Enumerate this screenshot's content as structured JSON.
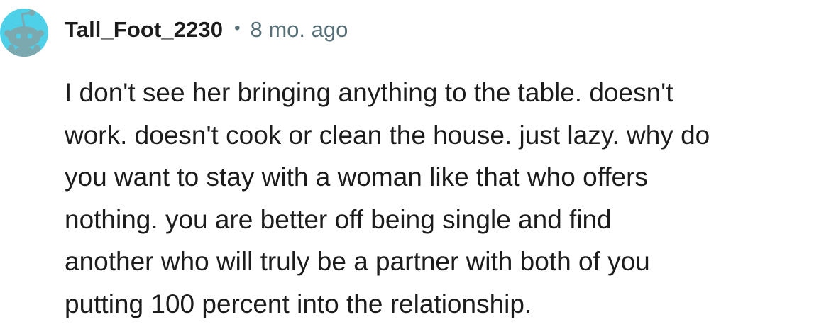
{
  "comment": {
    "username": "Tall_Foot_2230",
    "separator": "•",
    "timestamp": "8 mo. ago",
    "avatar_icon": "reddit-snoo-avatar-icon",
    "lines": [
      "I don't see her bringing anything to the table. doesn't",
      "work. doesn't cook or clean the house. just lazy. why do",
      "you want to stay with a woman like that who offers",
      "nothing. you are better off being single and find",
      "another who will truly be a partner with both of you",
      "putting 100 percent into the relationship."
    ]
  },
  "colors": {
    "avatar_background": "#4fd0e9",
    "avatar_figure": "#7ca9b0",
    "text": "#1c1c1c",
    "meta_text": "#576f76"
  }
}
